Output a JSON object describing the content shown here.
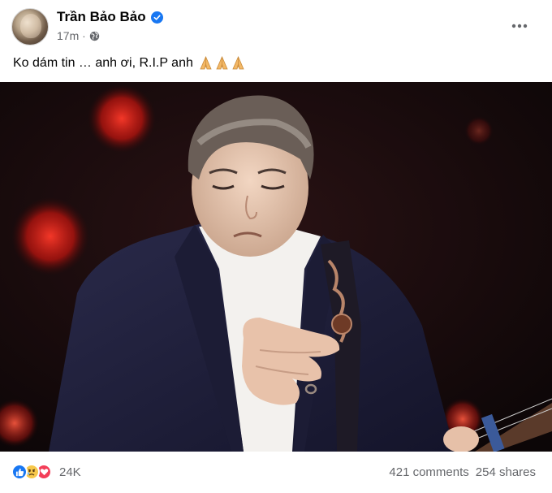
{
  "post": {
    "author": "Trần Bảo Bảo",
    "verified": true,
    "time": "17m",
    "privacy_icon": "globe-icon",
    "caption": "Ko dám tin … anh ơi, R.I.P anh",
    "caption_emoji": [
      "🙏",
      "🙏",
      "🙏"
    ],
    "photo_description_icon": "photo"
  },
  "reactions": {
    "types": [
      "like",
      "sad",
      "love"
    ],
    "count": "24K"
  },
  "stats": {
    "comments": "421 comments",
    "shares": "254 shares"
  },
  "colors": {
    "accent": "#1877f2",
    "secondary_text": "#65676b",
    "love": "#f33e58",
    "sad": "#f7c84b"
  }
}
